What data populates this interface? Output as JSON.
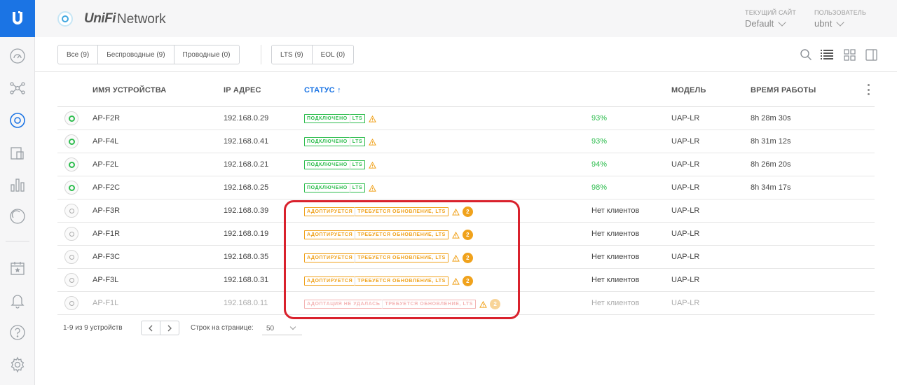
{
  "app": {
    "brand_uni": "UniFi",
    "brand_network": "Network"
  },
  "header": {
    "site_label": "ТЕКУЩИЙ САЙТ",
    "site_value": "Default",
    "user_label": "ПОЛЬЗОВАТЕЛЬ",
    "user_value": "ubnt"
  },
  "filters": {
    "all": "Все (9)",
    "wireless": "Беспроводные (9)",
    "wired": "Проводные (0)",
    "lts": "LTS (9)",
    "eol": "EOL (0)"
  },
  "columns": {
    "name": "ИМЯ УСТРОЙСТВА",
    "ip": "IP АДРЕС",
    "status": "СТАТУС",
    "model": "МОДЕЛЬ",
    "uptime": "ВРЕМЯ РАБОТЫ"
  },
  "rows": [
    {
      "name": "AP-F2R",
      "ip": "192.168.0.29",
      "chip1": "ПОДКЛЮЧЕНО",
      "chip2": "LTS",
      "badge": "",
      "clients": "93%",
      "model": "UAP-LR",
      "uptime": "8h 28m 30s"
    },
    {
      "name": "AP-F4L",
      "ip": "192.168.0.41",
      "chip1": "ПОДКЛЮЧЕНО",
      "chip2": "LTS",
      "badge": "",
      "clients": "93%",
      "model": "UAP-LR",
      "uptime": "8h 31m 12s"
    },
    {
      "name": "AP-F2L",
      "ip": "192.168.0.21",
      "chip1": "ПОДКЛЮЧЕНО",
      "chip2": "LTS",
      "badge": "",
      "clients": "94%",
      "model": "UAP-LR",
      "uptime": "8h 26m 20s"
    },
    {
      "name": "AP-F2C",
      "ip": "192.168.0.25",
      "chip1": "ПОДКЛЮЧЕНО",
      "chip2": "LTS",
      "badge": "",
      "clients": "98%",
      "model": "UAP-LR",
      "uptime": "8h 34m 17s"
    },
    {
      "name": "AP-F3R",
      "ip": "192.168.0.39",
      "chip1": "АДОПТИРУЕТСЯ",
      "chip2": "ТРЕБУЕТСЯ ОБНОВЛЕНИЕ, LTS",
      "badge": "2",
      "clients": "Нет клиентов",
      "model": "UAP-LR",
      "uptime": ""
    },
    {
      "name": "AP-F1R",
      "ip": "192.168.0.19",
      "chip1": "АДОПТИРУЕТСЯ",
      "chip2": "ТРЕБУЕТСЯ ОБНОВЛЕНИЕ, LTS",
      "badge": "2",
      "clients": "Нет клиентов",
      "model": "UAP-LR",
      "uptime": ""
    },
    {
      "name": "AP-F3C",
      "ip": "192.168.0.35",
      "chip1": "АДОПТИРУЕТСЯ",
      "chip2": "ТРЕБУЕТСЯ ОБНОВЛЕНИЕ, LTS",
      "badge": "2",
      "clients": "Нет клиентов",
      "model": "UAP-LR",
      "uptime": ""
    },
    {
      "name": "AP-F3L",
      "ip": "192.168.0.31",
      "chip1": "АДОПТИРУЕТСЯ",
      "chip2": "ТРЕБУЕТСЯ ОБНОВЛЕНИЕ, LTS",
      "badge": "2",
      "clients": "Нет клиентов",
      "model": "UAP-LR",
      "uptime": ""
    },
    {
      "name": "AP-F1L",
      "ip": "192.168.0.11",
      "chip1": "АДОПТАЦИЯ НЕ УДАЛАСЬ",
      "chip2": "ТРЕБУЕТСЯ ОБНОВЛЕНИЕ, LTS",
      "badge": "2",
      "clients": "Нет клиентов",
      "model": "UAP-LR",
      "uptime": ""
    }
  ],
  "pagination": {
    "count": "1-9 из 9 устройств",
    "per_page_label": "Строк на странице:",
    "per_page_value": "50"
  },
  "colors": {
    "accent": "#1b74e4",
    "connected": "#2ebd4e",
    "adopting": "#f0a21c",
    "failed": "#e55a5a",
    "highlight": "#d9212c"
  },
  "icons": [
    "ubiquiti-logo-icon",
    "dashboard-icon",
    "topology-icon",
    "devices-icon",
    "clients-icon",
    "statistics-icon",
    "insights-icon",
    "events-icon",
    "alerts-icon",
    "help-icon",
    "settings-icon",
    "search-icon",
    "list-view-icon",
    "grid-view-icon",
    "panel-view-icon",
    "warning-icon"
  ]
}
